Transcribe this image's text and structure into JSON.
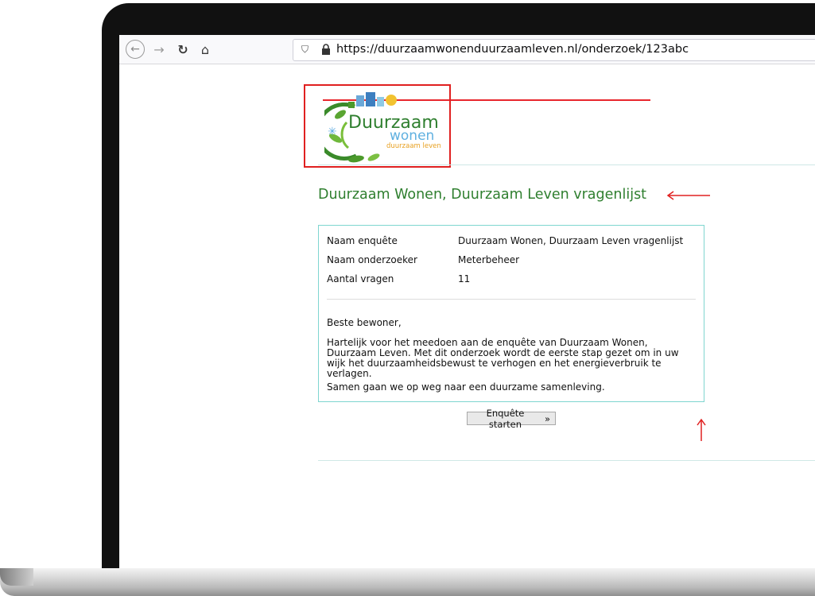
{
  "browser": {
    "url": "https://duurzaamwonenduurzaamleven.nl/onderzoek/123abc",
    "back_icon": "back-arrow-icon",
    "forward_icon": "forward-arrow-icon",
    "reload_icon": "reload-icon",
    "home_icon": "home-icon"
  },
  "logo": {
    "line1": "Duurzaam",
    "line2": "wonen",
    "line3": "duurzaam leven"
  },
  "page": {
    "title": "Duurzaam Wonen, Duurzaam Leven vragenlijst"
  },
  "survey_info": [
    {
      "label": "Naam enquête",
      "value": "Duurzaam Wonen, Duurzaam Leven vragenlijst"
    },
    {
      "label": "Naam onderzoeker",
      "value": "Meterbeheer"
    },
    {
      "label": "Aantal vragen",
      "value": "11"
    }
  ],
  "message": {
    "greeting": "Beste bewoner,",
    "body": "Hartelijk voor het meedoen aan de enquête van Duurzaam Wonen, Duurzaam Leven. Met dit onderzoek wordt de eerste stap gezet om in uw wijk het duurzaamheidsbewust te verhogen en het energieverbruik te verlagen.",
    "closing": "Samen gaan we op weg naar een duurzame samenleving."
  },
  "actions": {
    "start_label": "Enquête starten",
    "start_chevron": "»"
  },
  "colors": {
    "annotation_red": "#e02020",
    "title_green": "#2f7f2f",
    "card_border": "#7fd6d0"
  }
}
